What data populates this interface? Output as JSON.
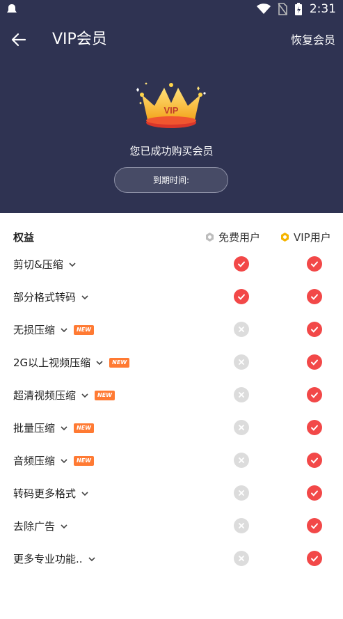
{
  "status_bar": {
    "time": "2:31"
  },
  "toolbar": {
    "title": "VIP会员",
    "restore_label": "恢复会员"
  },
  "membership": {
    "success_text": "您已成功购买会员",
    "expire_label": "到期时间:"
  },
  "table": {
    "header": {
      "benefits": "权益",
      "free": "免费用户",
      "vip": "VIP用户"
    },
    "new_badge": "NEW",
    "rows": [
      {
        "label": "剪切&压缩",
        "is_new": false,
        "free": true,
        "vip": true
      },
      {
        "label": "部分格式转码",
        "is_new": false,
        "free": true,
        "vip": true
      },
      {
        "label": "无损压缩",
        "is_new": true,
        "free": false,
        "vip": true
      },
      {
        "label": "2G以上视频压缩",
        "is_new": true,
        "free": false,
        "vip": true
      },
      {
        "label": "超清视频压缩",
        "is_new": true,
        "free": false,
        "vip": true
      },
      {
        "label": "批量压缩",
        "is_new": true,
        "free": false,
        "vip": true
      },
      {
        "label": "音频压缩",
        "is_new": true,
        "free": false,
        "vip": true
      },
      {
        "label": "转码更多格式",
        "is_new": false,
        "free": false,
        "vip": true
      },
      {
        "label": "去除广告",
        "is_new": false,
        "free": false,
        "vip": true
      },
      {
        "label": "更多专业功能..",
        "is_new": false,
        "free": false,
        "vip": true
      }
    ]
  },
  "colors": {
    "header_bg": "#2f3352",
    "check_red": "#f24848",
    "cross_gray": "#dcdcdc",
    "new_badge": "#ff7a33",
    "vip_gold": "#f5b400"
  },
  "icons": {
    "back": "arrow-left-icon",
    "crown": "vip-crown-icon",
    "check": "check-icon",
    "cross": "cross-icon",
    "chevron": "chevron-down-icon"
  }
}
